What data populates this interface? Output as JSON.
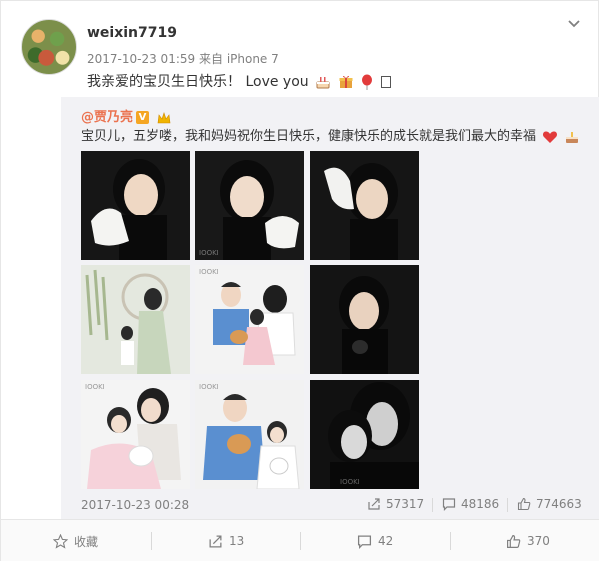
{
  "user": {
    "name": "weixin7719"
  },
  "meta": {
    "time": "2017-10-23 01:59",
    "source_prefix": "来自",
    "source": "iPhone 7"
  },
  "post": {
    "text": "我亲爱的宝贝生日快乐！ Love you"
  },
  "repost": {
    "author": "@贾乃亮",
    "text": "宝贝儿，五岁喽，我和妈妈祝你生日快乐，健康快乐的成长就是我们最大的幸福",
    "time": "2017-10-23 00:28",
    "shares": "57317",
    "comments": "48186",
    "likes": "774663"
  },
  "actions": {
    "favorite": "收藏",
    "share": "13",
    "comment": "42",
    "like": "370"
  },
  "colors": {
    "author": "#eb7350",
    "repost_bg": "#f2f2f5",
    "meta": "#808080"
  },
  "icons": [
    "chevron-down-icon",
    "cake-icon",
    "gift-icon",
    "balloon-icon",
    "heart-icon",
    "share-icon",
    "comment-icon",
    "like-icon",
    "star-icon"
  ]
}
